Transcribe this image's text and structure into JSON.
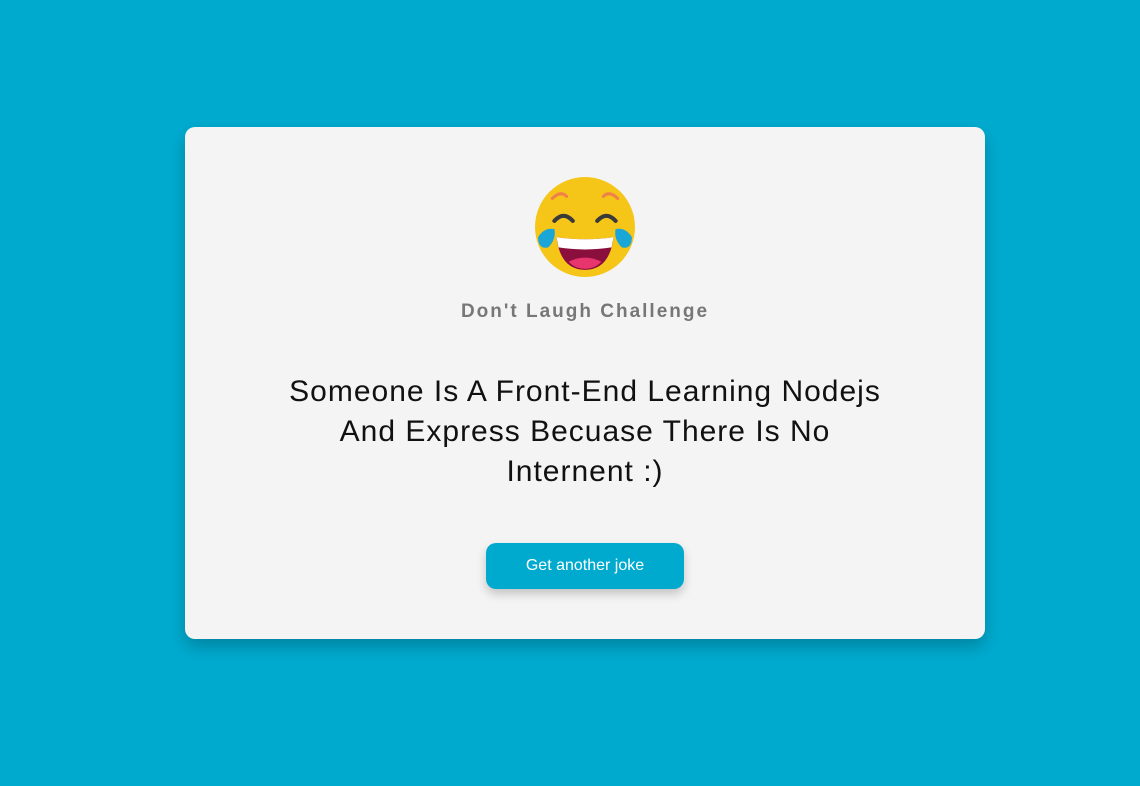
{
  "header": {
    "icon": "face-with-tears-of-joy-icon",
    "subtitle": "Don't Laugh Challenge"
  },
  "joke": {
    "text": "Someone Is A Front-End Learning Nodejs And Express Becuase There Is No Internent :)"
  },
  "actions": {
    "next_label": "Get another joke"
  },
  "colors": {
    "background": "#00aacf",
    "card": "#f4f4f4",
    "button": "#00aacf",
    "subtitle": "#777777"
  }
}
